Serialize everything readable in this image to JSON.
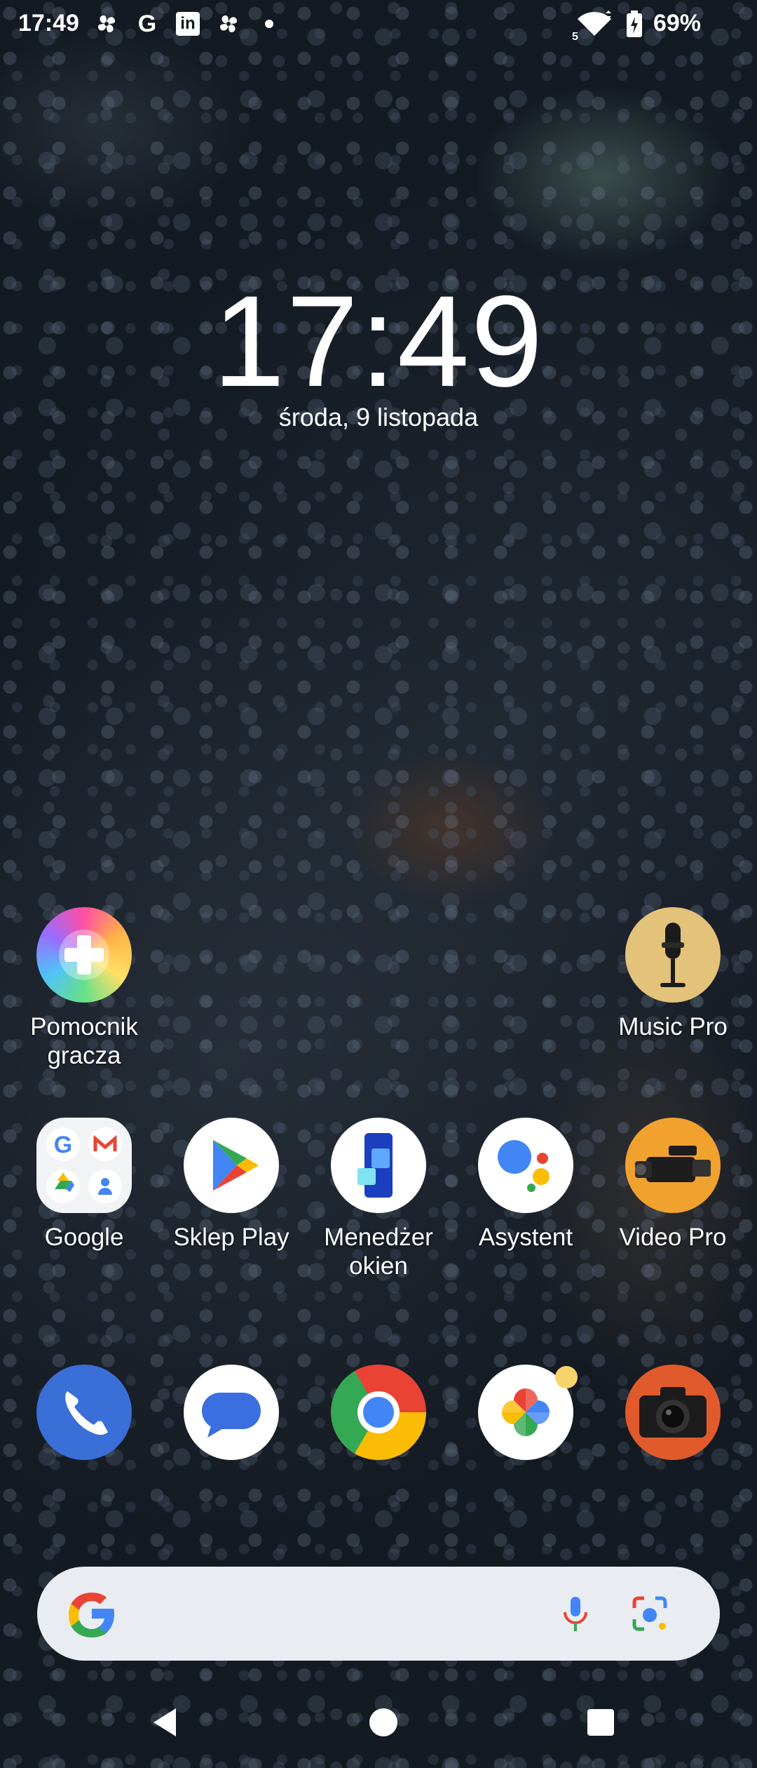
{
  "status_bar": {
    "time": "17:49",
    "notification_icons": [
      "pinwheel-icon",
      "google-g-icon",
      "linkedin-icon",
      "pinwheel-icon",
      "dot-icon"
    ],
    "linkedin_glyph": "in",
    "google_glyph": "G",
    "wifi_badge": "5",
    "battery": "69%"
  },
  "lockclock": {
    "time": "17:49",
    "date": "środa, 9 listopada"
  },
  "apps_row1": [
    {
      "label": "Pomocnik\ngracza",
      "icon": "game-enhancer-icon"
    },
    {
      "label": "Music Pro",
      "icon": "music-pro-icon"
    }
  ],
  "apps_row2": [
    {
      "label": "Google",
      "icon": "google-folder-icon"
    },
    {
      "label": "Sklep Play",
      "icon": "play-store-icon"
    },
    {
      "label": "Menedżer\nokien",
      "icon": "window-manager-icon"
    },
    {
      "label": "Asystent",
      "icon": "assistant-icon"
    },
    {
      "label": "Video Pro",
      "icon": "video-pro-icon"
    }
  ],
  "dock": [
    {
      "name": "Telefon",
      "icon": "phone-icon"
    },
    {
      "name": "Wiadomości",
      "icon": "messages-icon"
    },
    {
      "name": "Chrome",
      "icon": "chrome-icon"
    },
    {
      "name": "Zdjęcia",
      "icon": "photos-icon"
    },
    {
      "name": "Aparat",
      "icon": "camera-icon"
    }
  ],
  "search": {
    "logo": "google-g-icon",
    "mic": "mic-icon",
    "lens": "lens-icon"
  },
  "colors": {
    "google_blue": "#4285F4",
    "google_red": "#EA4335",
    "google_yellow": "#FBBC05",
    "google_green": "#34A853",
    "search_bg": "#e9ecf1"
  }
}
